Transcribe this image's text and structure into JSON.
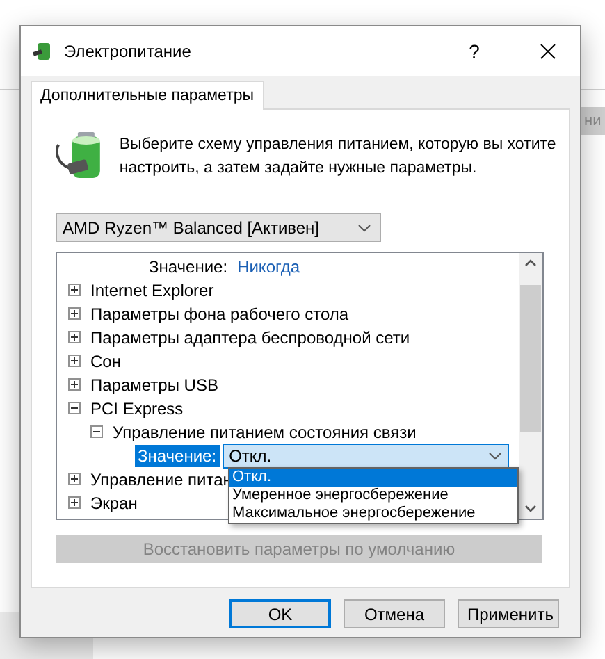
{
  "background": {
    "button_fragment": "ни"
  },
  "window": {
    "title": "Электропитание",
    "help": "?"
  },
  "tabs": [
    {
      "label": "Дополнительные параметры",
      "selected": true
    }
  ],
  "description": "Выберите схему управления питанием, которую вы хотите настроить, а затем задайте нужные параметры.",
  "plan_select": {
    "value": "AMD Ryzen™ Balanced [Активен]"
  },
  "tree": [
    {
      "kind": "value",
      "label": "Значение:",
      "value": "Никогда",
      "selected": false
    },
    {
      "kind": "group",
      "label": "Internet Explorer",
      "expanded": false
    },
    {
      "kind": "group",
      "label": "Параметры фона рабочего стола",
      "expanded": false
    },
    {
      "kind": "group",
      "label": "Параметры адаптера беспроводной сети",
      "expanded": false
    },
    {
      "kind": "group",
      "label": "Сон",
      "expanded": false
    },
    {
      "kind": "group",
      "label": "Параметры USB",
      "expanded": false
    },
    {
      "kind": "group",
      "label": "PCI Express",
      "expanded": true,
      "children": [
        {
          "kind": "group",
          "label": "Управление питанием состояния связи",
          "expanded": true,
          "children": [
            {
              "kind": "setting",
              "label": "Значение:",
              "value": "Откл.",
              "selected": true
            }
          ]
        }
      ]
    },
    {
      "kind": "group",
      "label": "Управление питан",
      "expanded": false
    },
    {
      "kind": "group",
      "label": "Экран",
      "expanded": false
    }
  ],
  "dropdown_options": [
    {
      "label": "Откл.",
      "selected": true
    },
    {
      "label": "Умеренное энергосбережение",
      "selected": false
    },
    {
      "label": "Максимальное энергосбережение",
      "selected": false
    }
  ],
  "restore_button": {
    "label": "Восстановить параметры по умолчанию",
    "disabled": true
  },
  "buttons": [
    {
      "label": "OK",
      "default": true
    },
    {
      "label": "Отмена",
      "default": false
    },
    {
      "label": "Применить",
      "default": false
    }
  ]
}
